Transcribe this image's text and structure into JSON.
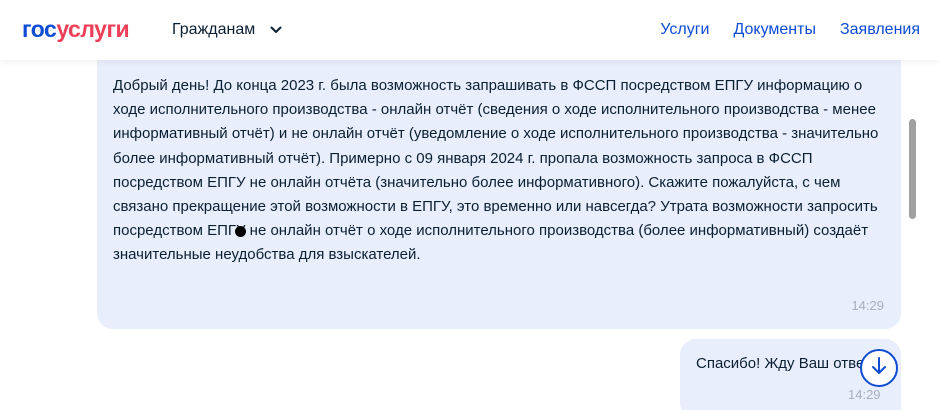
{
  "header": {
    "logo_part1": "гос",
    "logo_part2": "услуги",
    "citizens_label": "Гражданам",
    "nav": [
      "Услуги",
      "Документы",
      "Заявления"
    ]
  },
  "messages": [
    {
      "text": "Добрый день! До конца 2023 г. была возможность запрашивать в ФССП посредством ЕПГУ информацию о ходе исполнительного производства - онлайн отчёт (сведения о ходе исполнительного производства - менее информативный отчёт) и не онлайн отчёт (уведомление о ходе исполнительного производства - значительно более информативный отчёт). Примерно с 09 января 2024 г. пропала возможность запроса в ФССП посредством ЕПГУ не онлайн отчёта (значительно более информативного). Скажите пожалуйста, с чем связано прекращение этой возможности в ЕПГУ, это временно или навсегда? Утрата возможности запросить посредством ЕПГУ не онлайн отчёт о ходе исполнительного производства (более информативный) создаёт значительные неудобства для взыскателей.",
      "time": "14:29"
    },
    {
      "text": "Спасибо! Жду Ваш ответ",
      "time": "14:29"
    }
  ],
  "colors": {
    "brand_blue": "#0d4cd3",
    "brand_red": "#ee3f58",
    "bubble_bg": "#e8eefc",
    "text_dark": "#0b1f33",
    "time_gray": "#a8b0bb"
  },
  "icons": {
    "chevron": "chevron-down-icon",
    "scroll_down": "arrow-down-icon"
  }
}
